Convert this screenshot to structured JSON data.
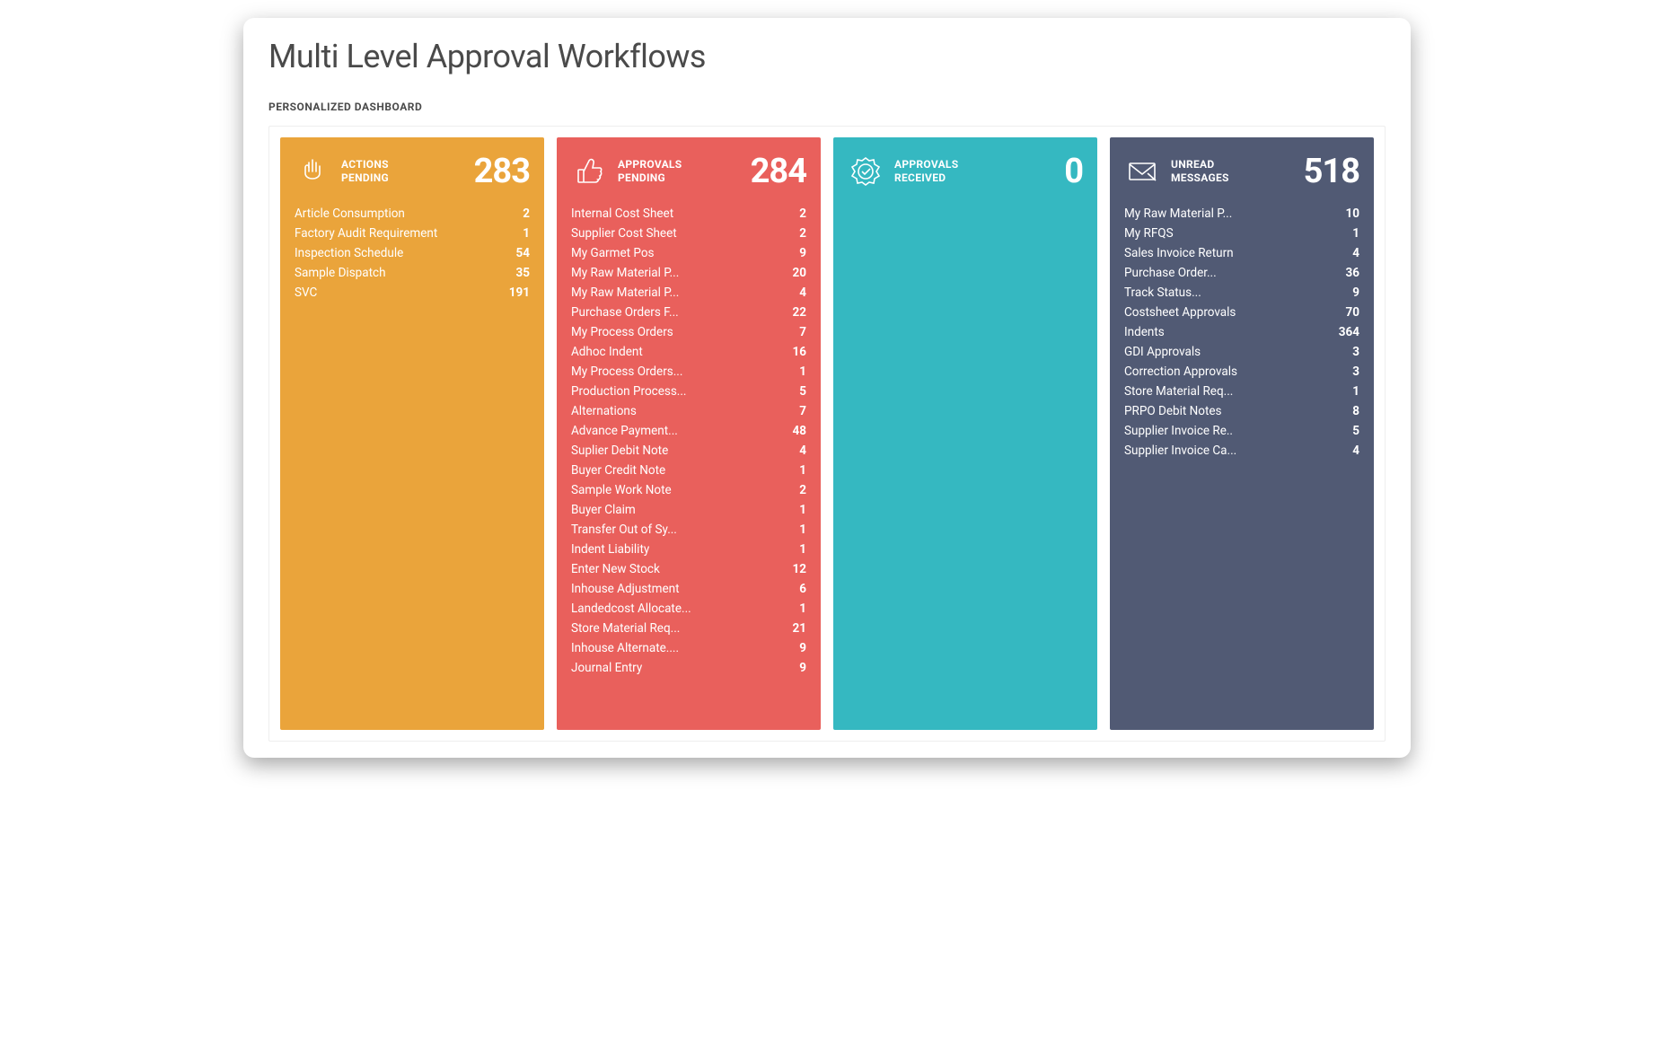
{
  "page": {
    "title": "Multi Level Approval Workflows",
    "subheading": "PERSONALIZED DASHBOARD"
  },
  "cards": [
    {
      "id": "actions-pending",
      "color": "orange",
      "icon": "pointer",
      "title": "ACTIONS\nPENDING",
      "count": "283",
      "items": [
        {
          "label": "Article Consumption",
          "value": "2"
        },
        {
          "label": "Factory Audit Requirement",
          "value": "1"
        },
        {
          "label": "Inspection Schedule",
          "value": "54"
        },
        {
          "label": "Sample Dispatch",
          "value": "35"
        },
        {
          "label": "SVC",
          "value": "191"
        }
      ]
    },
    {
      "id": "approvals-pending",
      "color": "red",
      "icon": "thumbs-up",
      "title": "APPROVALS\nPENDING",
      "count": "284",
      "items": [
        {
          "label": "Internal Cost Sheet",
          "value": "2"
        },
        {
          "label": "Supplier Cost Sheet",
          "value": "2"
        },
        {
          "label": "My Garmet Pos",
          "value": "9"
        },
        {
          "label": "My Raw Material P...",
          "value": "20"
        },
        {
          "label": "My Raw Material P...",
          "value": "4"
        },
        {
          "label": "Purchase Orders F...",
          "value": "22"
        },
        {
          "label": "My Process Orders",
          "value": "7"
        },
        {
          "label": "Adhoc Indent",
          "value": "16"
        },
        {
          "label": "My Process Orders...",
          "value": "1"
        },
        {
          "label": "Production Process...",
          "value": "5"
        },
        {
          "label": "Alternations",
          "value": "7"
        },
        {
          "label": "Advance Payment...",
          "value": "48"
        },
        {
          "label": "Suplier Debit Note",
          "value": "4"
        },
        {
          "label": "Buyer Credit Note",
          "value": "1"
        },
        {
          "label": "Sample Work Note",
          "value": "2"
        },
        {
          "label": "Buyer Claim",
          "value": "1"
        },
        {
          "label": "Transfer Out of Sy...",
          "value": "1"
        },
        {
          "label": "Indent Liability",
          "value": "1"
        },
        {
          "label": "Enter New Stock",
          "value": "12"
        },
        {
          "label": "Inhouse Adjustment",
          "value": "6"
        },
        {
          "label": "Landedcost Allocate...",
          "value": "1"
        },
        {
          "label": "Store Material Req...",
          "value": "21"
        },
        {
          "label": "Inhouse Alternate....",
          "value": "9"
        },
        {
          "label": "Journal Entry",
          "value": "9"
        }
      ]
    },
    {
      "id": "approvals-received",
      "color": "teal",
      "icon": "seal-check",
      "title": "APPROVALS\nRECEIVED",
      "count": "0",
      "items": []
    },
    {
      "id": "unread-messages",
      "color": "slate",
      "icon": "envelope",
      "title": "UNREAD\nMESSAGES",
      "count": "518",
      "items": [
        {
          "label": "My Raw Material P...",
          "value": "10"
        },
        {
          "label": "My RFQS",
          "value": "1"
        },
        {
          "label": "Sales Invoice Return",
          "value": "4"
        },
        {
          "label": "Purchase Order...",
          "value": "36"
        },
        {
          "label": "Track Status...",
          "value": "9"
        },
        {
          "label": "Costsheet Approvals",
          "value": "70"
        },
        {
          "label": "Indents",
          "value": "364"
        },
        {
          "label": "GDI Approvals",
          "value": "3"
        },
        {
          "label": "Correction Approvals",
          "value": "3"
        },
        {
          "label": "Store Material Req...",
          "value": "1"
        },
        {
          "label": "PRPO Debit Notes",
          "value": "8"
        },
        {
          "label": "Supplier Invoice Re..",
          "value": "5"
        },
        {
          "label": "Supplier Invoice Ca...",
          "value": "4"
        }
      ]
    }
  ]
}
